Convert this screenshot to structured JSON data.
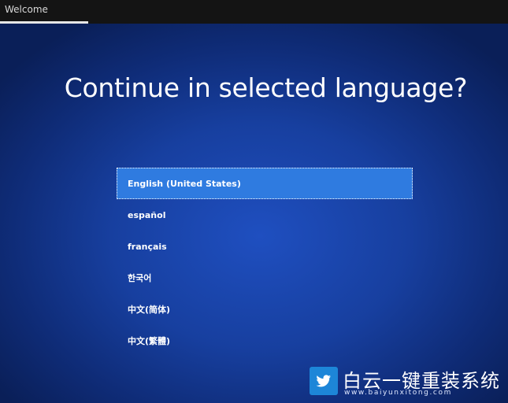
{
  "window": {
    "title": "Welcome"
  },
  "heading": "Continue in selected language?",
  "languages": [
    {
      "label": "English (United States)",
      "selected": true
    },
    {
      "label": "español",
      "selected": false
    },
    {
      "label": "français",
      "selected": false
    },
    {
      "label": "한국어",
      "selected": false
    },
    {
      "label": "中文(简体)",
      "selected": false
    },
    {
      "label": "中文(繁體)",
      "selected": false
    }
  ],
  "watermark": {
    "brand": "白云一键重装系统",
    "url": "www.baiyunxitong.com",
    "icon": "twitter-bird-icon"
  },
  "colors": {
    "selected_bg": "#2f7be0",
    "background": "#1a45a8"
  }
}
